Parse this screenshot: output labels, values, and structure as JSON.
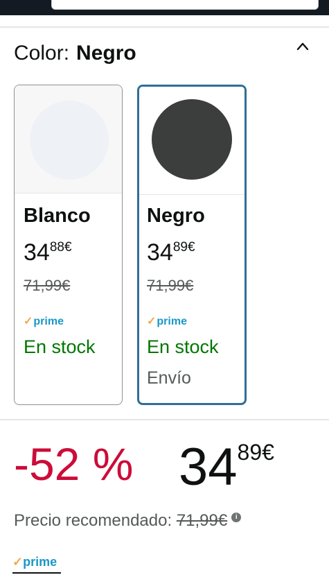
{
  "header": {
    "search_value": ""
  },
  "color_selector": {
    "label": "Color:",
    "selected_value": "Negro",
    "collapse_icon": "chevron-up-icon",
    "options": [
      {
        "name": "Blanco",
        "swatch_color": "#eef1f6",
        "price_whole": "34",
        "price_fraction": "88",
        "currency": "€",
        "list_price": "71,99€",
        "prime": "prime",
        "availability": "En stock",
        "shipping": "",
        "selected": false
      },
      {
        "name": "Negro",
        "swatch_color": "#3c3d3d",
        "price_whole": "34",
        "price_fraction": "89",
        "currency": "€",
        "list_price": "71,99€",
        "prime": "prime",
        "availability": "En stock",
        "shipping": "Envío",
        "selected": true
      }
    ]
  },
  "pricing": {
    "discount": "-52 %",
    "price_whole": "34",
    "price_fraction": "89",
    "currency": "€",
    "rrp_label": "Precio recomendado:",
    "rrp_value": "71,99€",
    "info_icon": "info-icon",
    "prime": "prime"
  },
  "colors": {
    "accent_selected": "#2f6e96",
    "discount_red": "#cc0c39",
    "stock_green": "#007600",
    "prime_blue": "#1a98c7",
    "prime_check": "#f3a847"
  }
}
